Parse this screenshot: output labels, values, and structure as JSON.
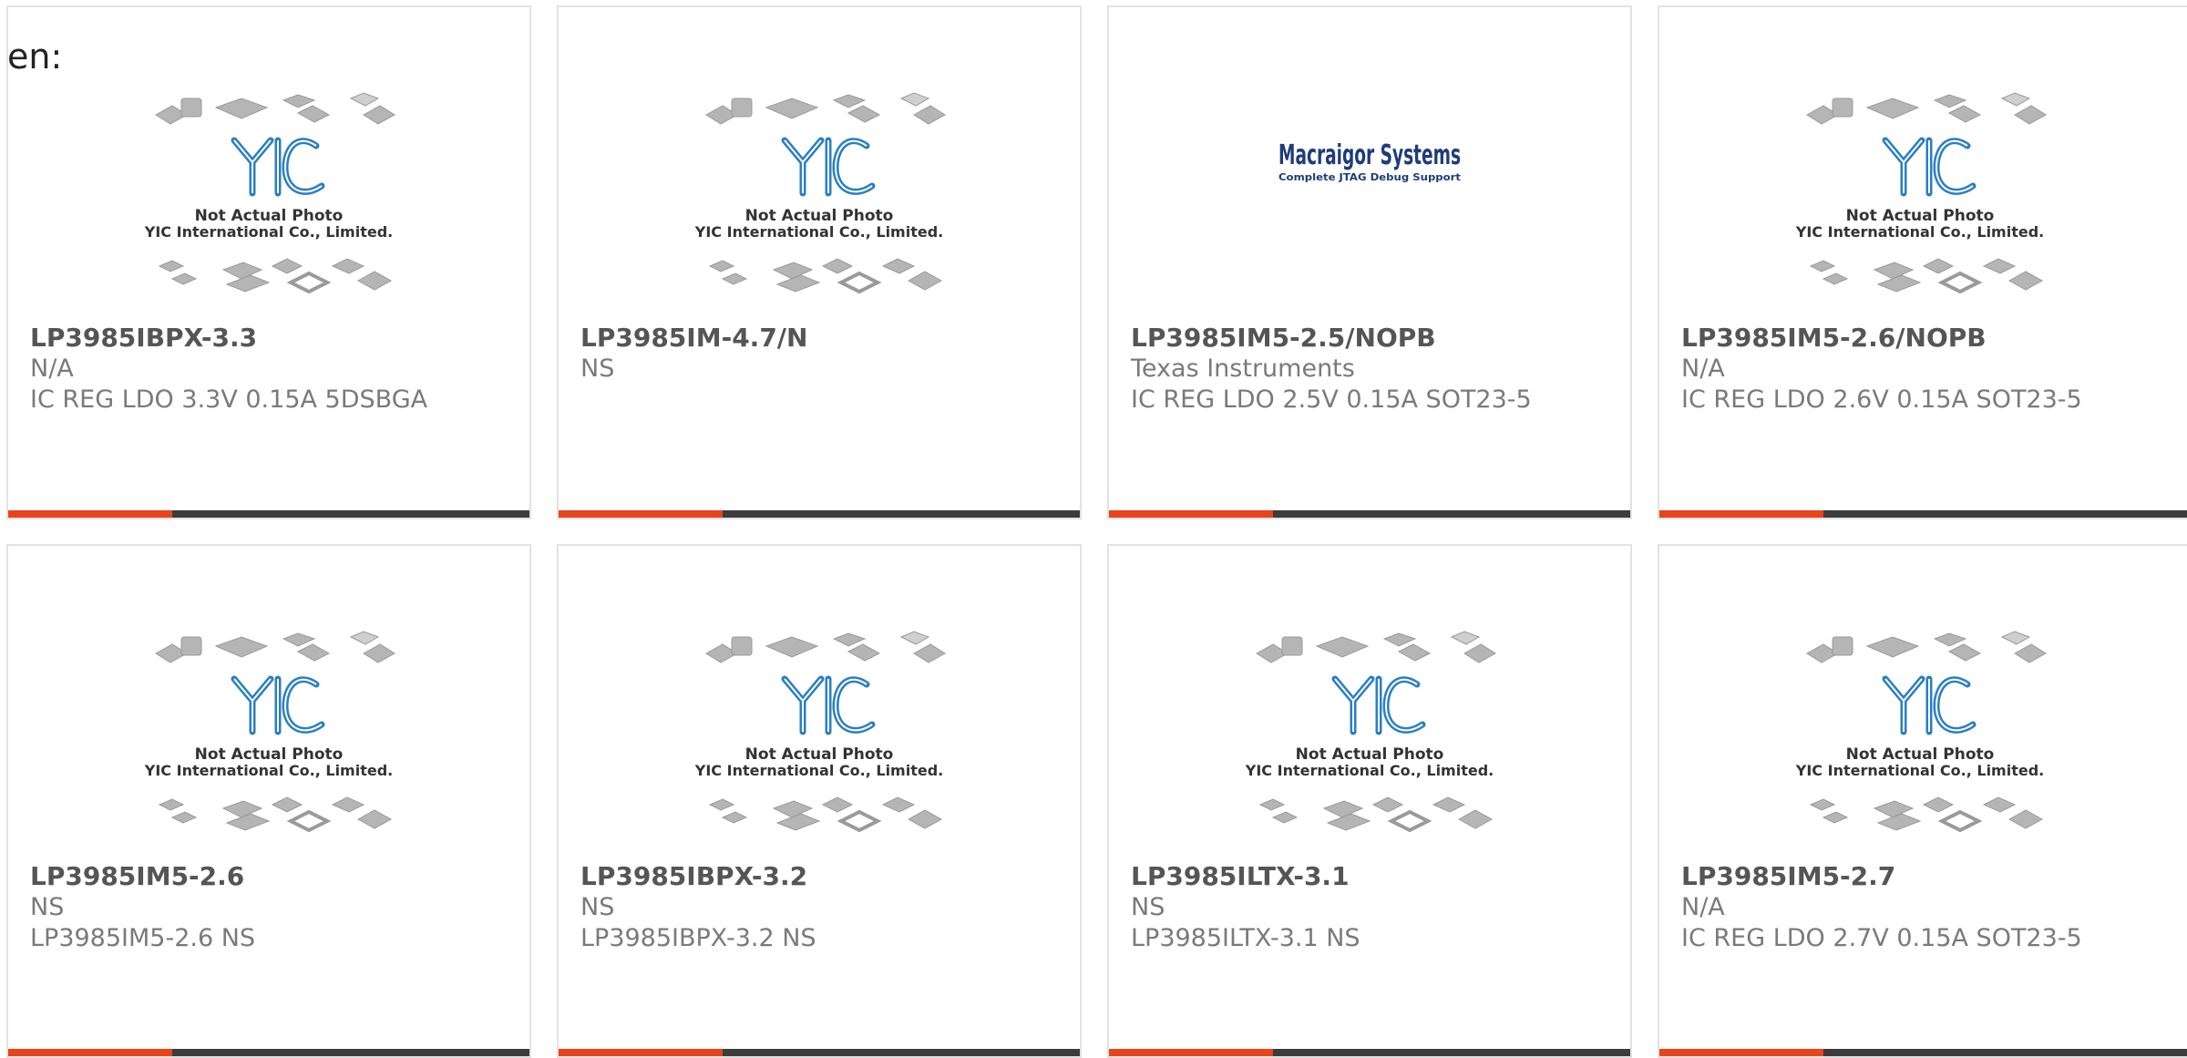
{
  "language_label": "en:",
  "colors": {
    "accent": "#e8431a",
    "bar": "#3c3c3c",
    "title": "#555555",
    "text": "#7a7a7a",
    "yic_blue": "#2a7fc4",
    "macraigor_blue": "#1f3c7a"
  },
  "placeholder": {
    "line1": "Not Actual Photo",
    "line2": "YIC International Co., Limited.",
    "logo": "YIC"
  },
  "macraigor": {
    "name": "Macraigor Systems",
    "tagline": "Complete JTAG Debug Support"
  },
  "products": [
    {
      "part": "LP3985IBPX-3.3",
      "manufacturer": "N/A",
      "description": "IC REG LDO 3.3V 0.15A 5DSBGA",
      "image": "yic-placeholder"
    },
    {
      "part": "LP3985IM-4.7/N",
      "manufacturer": "NS",
      "description": "",
      "image": "yic-placeholder"
    },
    {
      "part": "LP3985IM5-2.5/NOPB",
      "manufacturer": "Texas Instruments",
      "description": "IC REG LDO 2.5V 0.15A SOT23-5",
      "image": "macraigor-logo"
    },
    {
      "part": "LP3985IM5-2.6/NOPB",
      "manufacturer": "N/A",
      "description": "IC REG LDO 2.6V 0.15A SOT23-5",
      "image": "yic-placeholder"
    },
    {
      "part": "LP3985IM5-2.6",
      "manufacturer": "NS",
      "description": "LP3985IM5-2.6 NS",
      "image": "yic-placeholder"
    },
    {
      "part": "LP3985IBPX-3.2",
      "manufacturer": "NS",
      "description": "LP3985IBPX-3.2 NS",
      "image": "yic-placeholder"
    },
    {
      "part": "LP3985ILTX-3.1",
      "manufacturer": "NS",
      "description": "LP3985ILTX-3.1 NS",
      "image": "yic-placeholder"
    },
    {
      "part": "LP3985IM5-2.7",
      "manufacturer": "N/A",
      "description": "IC REG LDO 2.7V 0.15A SOT23-5",
      "image": "yic-placeholder"
    }
  ]
}
